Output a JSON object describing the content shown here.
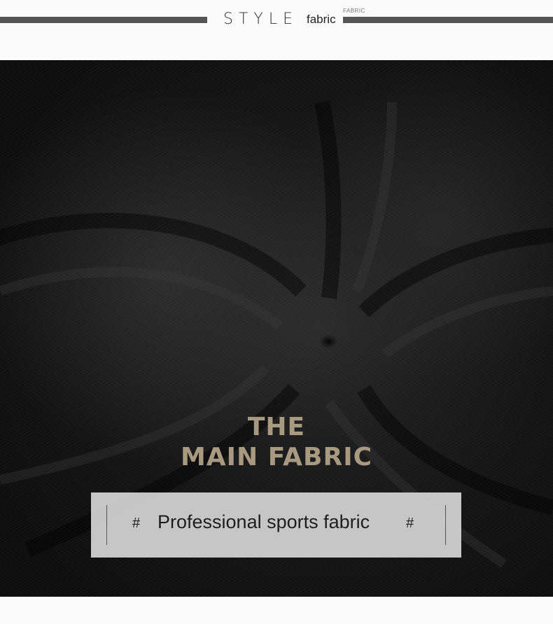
{
  "header": {
    "style_word": "STYLE",
    "fabric_word": "fabric",
    "fabric_small": "FABRIC"
  },
  "photo": {
    "subject": "black-sports-fabric-swirl"
  },
  "overlay": {
    "headline_line1": "THE",
    "headline_line2": "MAIN FABRIC",
    "caption": "Professional sports fabric",
    "hash_left": "#",
    "hash_right": "#"
  },
  "colors": {
    "background": "#fbfbfb",
    "rule": "#555555",
    "fabric_dark": "#161616",
    "headline": "#a89a80",
    "caption_box": "#d4d4d4"
  }
}
